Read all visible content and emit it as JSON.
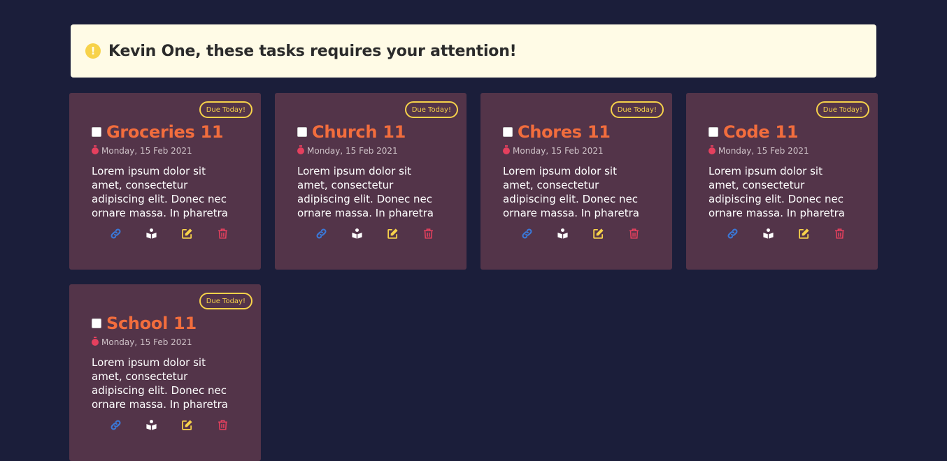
{
  "alert": {
    "icon": "exclamation-circle-icon",
    "text": "Kevin One, these tasks requires your attention!",
    "color": "#f7d24a"
  },
  "colors": {
    "background": "#1b1e3a",
    "card": "#533449",
    "title": "#f26d3d",
    "badge": "#f7d24a",
    "link_icon": "#3a78d8",
    "book_icon": "#ffffff",
    "edit_icon": "#f7d24a",
    "delete_icon": "#e5405e"
  },
  "cards": [
    {
      "badge": "Due Today!",
      "title": "Groceries 11",
      "date": "Monday, 15 Feb 2021",
      "description": "Lorem ipsum dolor sit amet, consectetur adipiscing elit. Donec nec ornare massa. In pharetra"
    },
    {
      "badge": "Due Today!",
      "title": "Church 11",
      "date": "Monday, 15 Feb 2021",
      "description": "Lorem ipsum dolor sit amet, consectetur adipiscing elit. Donec nec ornare massa. In pharetra"
    },
    {
      "badge": "Due Today!",
      "title": "Chores 11",
      "date": "Monday, 15 Feb 2021",
      "description": "Lorem ipsum dolor sit amet, consectetur adipiscing elit. Donec nec ornare massa. In pharetra"
    },
    {
      "badge": "Due Today!",
      "title": "Code 11",
      "date": "Monday, 15 Feb 2021",
      "description": "Lorem ipsum dolor sit amet, consectetur adipiscing elit. Donec nec ornare massa. In pharetra"
    },
    {
      "badge": "Due Today!",
      "title": "School 11",
      "date": "Monday, 15 Feb 2021",
      "description": "Lorem ipsum dolor sit amet, consectetur adipiscing elit. Donec nec ornare massa. In pharetra"
    }
  ],
  "actions": [
    "link-icon",
    "book-reader-icon",
    "edit-icon",
    "trash-icon"
  ]
}
